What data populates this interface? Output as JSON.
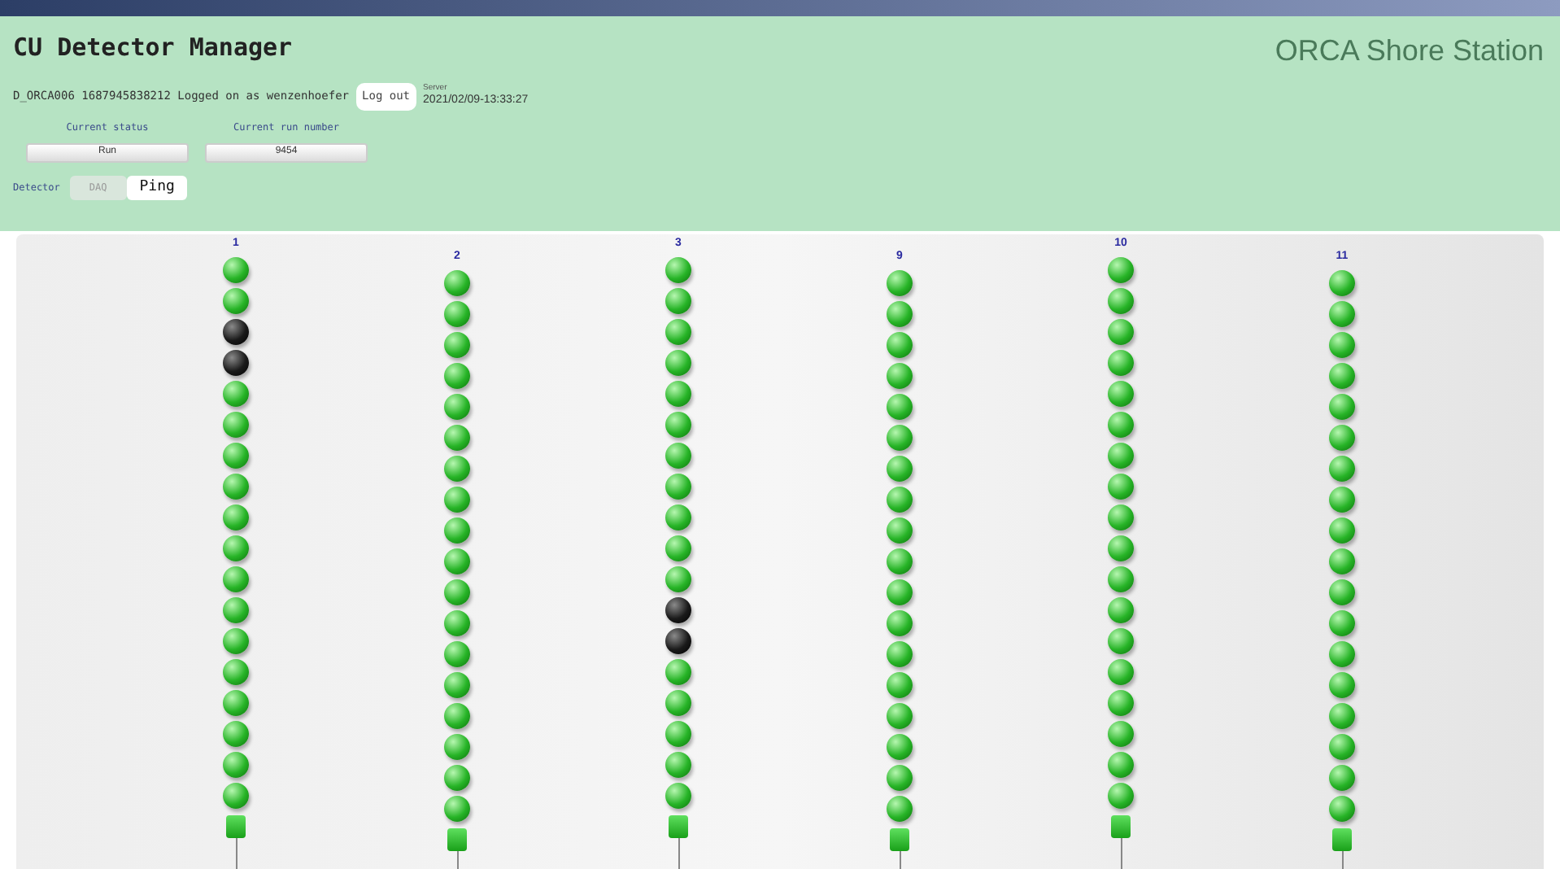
{
  "header": {
    "title": "CU Detector Manager",
    "site": "ORCA Shore Station",
    "session": "D_ORCA006 1687945838212 Logged on as wenzenhoefer",
    "logout": "Log out",
    "time_label": "Server",
    "time": "2021/02/09-13:33:27"
  },
  "status": {
    "label": "Current status",
    "value": "Run"
  },
  "run_number": {
    "label": "Current run number",
    "value": "9454"
  },
  "detector": {
    "label": "Detector",
    "tabs": [
      {
        "label": "DAQ",
        "selected": false
      },
      {
        "label": "Ping",
        "selected": true
      }
    ]
  },
  "strings": [
    {
      "label": "1",
      "doms": [
        {
          "on": true
        },
        {
          "on": true
        },
        {
          "on": false
        },
        {
          "on": false
        },
        {
          "on": true
        },
        {
          "on": true
        },
        {
          "on": true
        },
        {
          "on": true
        },
        {
          "on": true
        },
        {
          "on": true
        },
        {
          "on": true
        },
        {
          "on": true
        },
        {
          "on": true
        },
        {
          "on": true
        },
        {
          "on": true
        },
        {
          "on": true
        },
        {
          "on": true
        },
        {
          "on": true
        }
      ]
    },
    {
      "label": "2",
      "doms": [
        {
          "on": true
        },
        {
          "on": true
        },
        {
          "on": true
        },
        {
          "on": true
        },
        {
          "on": true
        },
        {
          "on": true
        },
        {
          "on": true
        },
        {
          "on": true
        },
        {
          "on": true
        },
        {
          "on": true
        },
        {
          "on": true
        },
        {
          "on": true
        },
        {
          "on": true
        },
        {
          "on": true
        },
        {
          "on": true
        },
        {
          "on": true
        },
        {
          "on": true
        },
        {
          "on": true
        }
      ]
    },
    {
      "label": "3",
      "doms": [
        {
          "on": true
        },
        {
          "on": true
        },
        {
          "on": true
        },
        {
          "on": true
        },
        {
          "on": true
        },
        {
          "on": true
        },
        {
          "on": true
        },
        {
          "on": true
        },
        {
          "on": true
        },
        {
          "on": true
        },
        {
          "on": true
        },
        {
          "on": false
        },
        {
          "on": false
        },
        {
          "on": true
        },
        {
          "on": true
        },
        {
          "on": true
        },
        {
          "on": true
        },
        {
          "on": true
        }
      ]
    },
    {
      "label": "9",
      "doms": [
        {
          "on": true
        },
        {
          "on": true
        },
        {
          "on": true
        },
        {
          "on": true
        },
        {
          "on": true
        },
        {
          "on": true
        },
        {
          "on": true
        },
        {
          "on": true
        },
        {
          "on": true
        },
        {
          "on": true
        },
        {
          "on": true
        },
        {
          "on": true
        },
        {
          "on": true
        },
        {
          "on": true
        },
        {
          "on": true
        },
        {
          "on": true
        },
        {
          "on": true
        },
        {
          "on": true
        }
      ]
    },
    {
      "label": "10",
      "doms": [
        {
          "on": true
        },
        {
          "on": true
        },
        {
          "on": true
        },
        {
          "on": true
        },
        {
          "on": true
        },
        {
          "on": true
        },
        {
          "on": true
        },
        {
          "on": true
        },
        {
          "on": true
        },
        {
          "on": true
        },
        {
          "on": true
        },
        {
          "on": true
        },
        {
          "on": true
        },
        {
          "on": true
        },
        {
          "on": true
        },
        {
          "on": true
        },
        {
          "on": true
        },
        {
          "on": true
        }
      ]
    },
    {
      "label": "11",
      "doms": [
        {
          "on": true
        },
        {
          "on": true
        },
        {
          "on": true
        },
        {
          "on": true
        },
        {
          "on": true
        },
        {
          "on": true
        },
        {
          "on": true
        },
        {
          "on": true
        },
        {
          "on": true
        },
        {
          "on": true
        },
        {
          "on": true
        },
        {
          "on": true
        },
        {
          "on": true
        },
        {
          "on": true
        },
        {
          "on": true
        },
        {
          "on": true
        },
        {
          "on": true
        },
        {
          "on": true
        }
      ]
    }
  ]
}
